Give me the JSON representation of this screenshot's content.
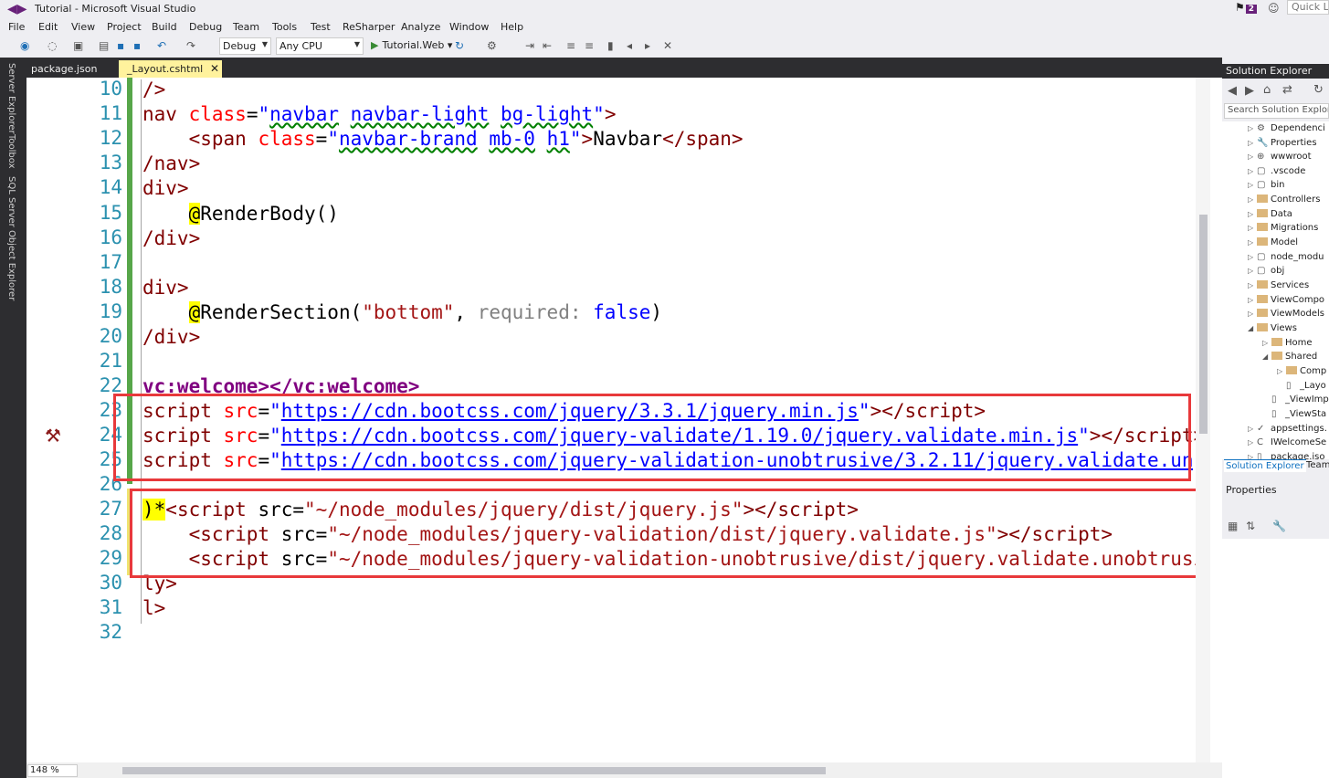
{
  "window": {
    "title": "Tutorial - Microsoft Visual Studio",
    "notifications": "2",
    "quick_launch": "Quick La"
  },
  "menu": [
    "File",
    "Edit",
    "View",
    "Project",
    "Build",
    "Debug",
    "Team",
    "Tools",
    "Test",
    "ReSharper",
    "Analyze",
    "Window",
    "Help"
  ],
  "toolbar": {
    "config": "Debug",
    "platform": "Any CPU",
    "run_target": "Tutorial.Web"
  },
  "left_tools": [
    "Server Explorer",
    "Toolbox",
    "SQL Server Object Explorer"
  ],
  "tabs": [
    {
      "label": "package.json"
    },
    {
      "label": "_Layout.cshtml"
    }
  ],
  "editor": {
    "zoom": "148 %",
    "line_numbers": [
      "10",
      "11",
      "12",
      "13",
      "14",
      "15",
      "16",
      "17",
      "18",
      "19",
      "20",
      "21",
      "22",
      "23",
      "24",
      "25",
      "26",
      "27",
      "28",
      "29",
      "30",
      "31",
      "32"
    ]
  },
  "solution_explorer": {
    "title": "Solution Explorer",
    "search_placeholder": "Search Solution Explorer",
    "items": [
      "Dependenci",
      "Properties",
      "wwwroot",
      ".vscode",
      "bin",
      "Controllers",
      "Data",
      "Migrations",
      "Model",
      "node_modu",
      "obj",
      "Services",
      "ViewCompo",
      "ViewModels",
      "Views",
      "Home",
      "Shared",
      "Comp",
      "_Layo",
      "_ViewImp",
      "_ViewSta",
      "appsettings.",
      "IWelcomeSe",
      "package.jso"
    ],
    "tab_active": "Solution Explorer",
    "tab_other": "Team"
  },
  "properties": {
    "title": "Properties"
  }
}
